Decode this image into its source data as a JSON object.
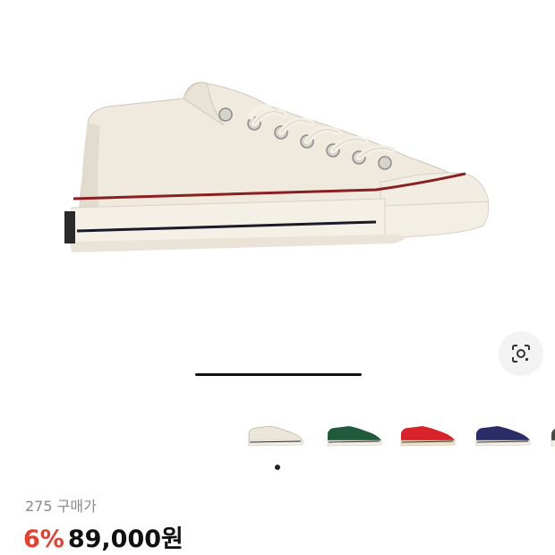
{
  "hero": {
    "image_name": "white low-top canvas sneaker"
  },
  "lens_button": {
    "icon": "image-search-icon"
  },
  "thumbnails": [
    {
      "name": "cream",
      "upper": "#ece6da"
    },
    {
      "name": "green",
      "upper": "#1f5a3d"
    },
    {
      "name": "red",
      "upper": "#d9232a"
    },
    {
      "name": "navy",
      "upper": "#2b2e66"
    },
    {
      "name": "grey",
      "upper": "#4a4a45"
    }
  ],
  "pagination": {
    "active_index": 0
  },
  "product": {
    "size_label": "275 구매가",
    "discount": "6%",
    "price": "89,000원"
  },
  "colors": {
    "discount": "#e5402f",
    "text": "#111111",
    "muted": "#8a8a8a"
  }
}
